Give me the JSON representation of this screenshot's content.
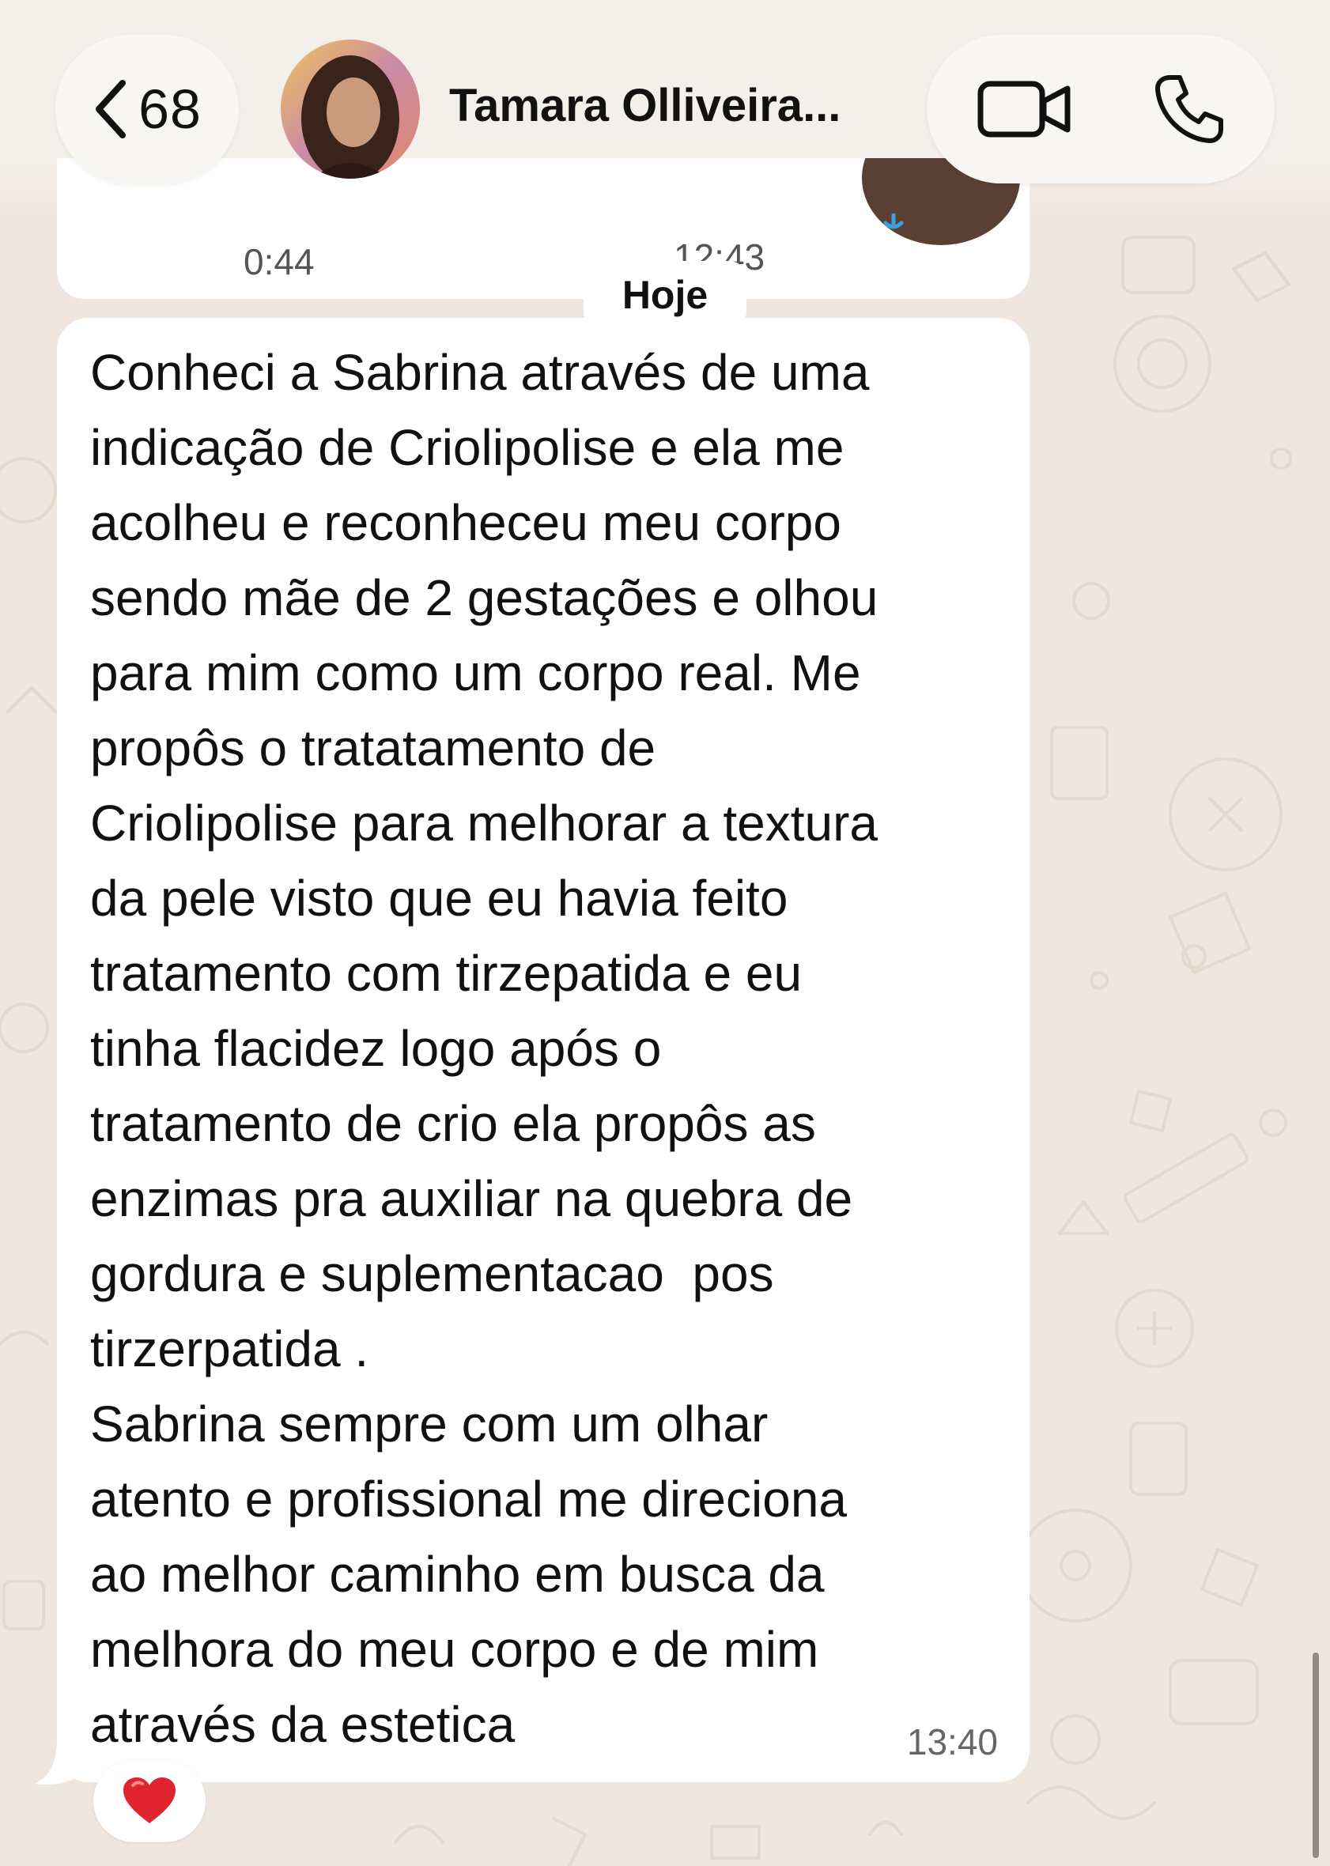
{
  "colors": {
    "wallpaper": "#efe7dd",
    "header_pill": "#f8f6f2",
    "bubble": "#ffffff",
    "reaction_heart": "#e0242f"
  },
  "header": {
    "back_count": "68",
    "contact_name": "Tamara Olliveira...",
    "icons": [
      "chevron-left-icon",
      "video-call-icon",
      "phone-call-icon"
    ]
  },
  "previous_message": {
    "audio_duration": "0:44",
    "time": "12:43"
  },
  "date_separator": "Hoje",
  "message": {
    "text": "Conheci a Sabrina através de uma\nindicação de Criolipolise e ela me\nacolheu e reconheceu meu corpo\nsendo mãe de 2 gestações e olhou\npara mim como um corpo real. Me\npropôs o tratatamento de\nCriolipolise para melhorar a textura\nda pele visto que eu havia feito\ntratamento com tirzepatida e eu\ntinha flacidez logo após o\ntratamento de crio ela propôs as\nenzimas pra auxiliar na quebra de\ngordura e suplementacao  pos\ntirzerpatida .\nSabrina sempre com um olhar\natento e profissional me direciona\nao melhor caminho em busca da\nmelhora do meu corpo e de mim\natravés da estetica",
    "time": "13:40",
    "reaction": "heart-icon"
  }
}
